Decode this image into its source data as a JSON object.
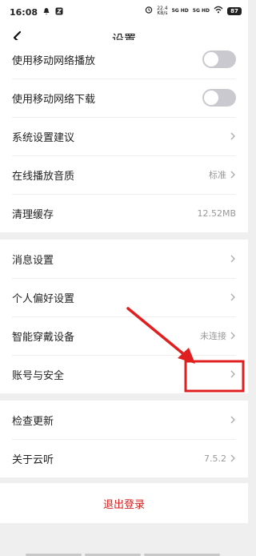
{
  "status_bar": {
    "time": "16:08",
    "speed_value": "22.4",
    "speed_unit": "KB/s",
    "net1": "5G HD",
    "net2": "5G HD",
    "battery": "87"
  },
  "header": {
    "title": "设置"
  },
  "groups": [
    {
      "rows": [
        {
          "label": "使用移动网络播放",
          "control": "toggle",
          "checked": false
        },
        {
          "label": "使用移动网络下载",
          "control": "toggle",
          "checked": false
        },
        {
          "label": "系统设置建议",
          "control": "chevron"
        },
        {
          "label": "在线播放音质",
          "value": "标准",
          "control": "chevron"
        },
        {
          "label": "清理缓存",
          "value": "12.52MB"
        }
      ]
    },
    {
      "rows": [
        {
          "label": "消息设置",
          "control": "chevron"
        },
        {
          "label": "个人偏好设置",
          "control": "chevron"
        },
        {
          "label": "智能穿戴设备",
          "value": "未连接",
          "control": "chevron"
        },
        {
          "label": "账号与安全",
          "control": "chevron"
        }
      ]
    },
    {
      "rows": [
        {
          "label": "检查更新",
          "control": "chevron"
        },
        {
          "label": "关于云听",
          "value": "7.5.2",
          "control": "chevron"
        }
      ]
    }
  ],
  "logout": {
    "label": "退出登录"
  },
  "colors": {
    "annotation": "#e02020",
    "logout_text": "#d81e1e",
    "toggle_off": "#c9c9cf"
  }
}
